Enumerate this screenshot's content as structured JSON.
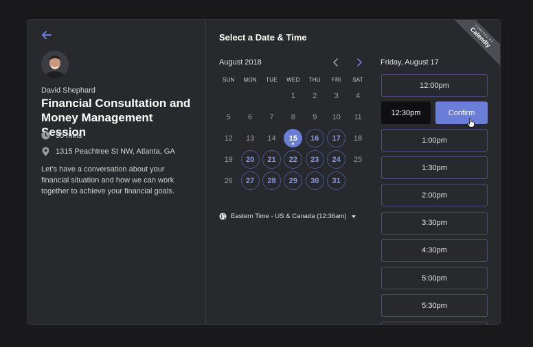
{
  "host": {
    "name": "David Shephard"
  },
  "event": {
    "title": "Financial Consultation and Money Management Session",
    "duration": "30 mins",
    "location": "1315 Peachtree St NW, Atlanta, GA",
    "description": "Let’s have a conversation about your financial situation and how we can work together to achieve your financial goals."
  },
  "scheduler": {
    "title": "Select a Date & Time",
    "month": "August 2018",
    "weekdays": [
      "SUN",
      "MON",
      "TUE",
      "WED",
      "THU",
      "FRI",
      "SAT"
    ],
    "timezone": "Eastern Time - US & Canada (12:36am)"
  },
  "calendar": {
    "leading_blanks": 3,
    "days": [
      {
        "n": "1",
        "available": false
      },
      {
        "n": "2",
        "available": false
      },
      {
        "n": "3",
        "available": false
      },
      {
        "n": "4",
        "available": false
      },
      {
        "n": "5",
        "available": false
      },
      {
        "n": "6",
        "available": false
      },
      {
        "n": "7",
        "available": false
      },
      {
        "n": "8",
        "available": false
      },
      {
        "n": "9",
        "available": false
      },
      {
        "n": "10",
        "available": false
      },
      {
        "n": "11",
        "available": false
      },
      {
        "n": "12",
        "available": false
      },
      {
        "n": "13",
        "available": false
      },
      {
        "n": "14",
        "available": false
      },
      {
        "n": "15",
        "available": true,
        "selected": true
      },
      {
        "n": "16",
        "available": true
      },
      {
        "n": "17",
        "available": true
      },
      {
        "n": "18",
        "available": false
      },
      {
        "n": "19",
        "available": false
      },
      {
        "n": "20",
        "available": true
      },
      {
        "n": "21",
        "available": true
      },
      {
        "n": "22",
        "available": true
      },
      {
        "n": "23",
        "available": true
      },
      {
        "n": "24",
        "available": true
      },
      {
        "n": "25",
        "available": false
      },
      {
        "n": "26",
        "available": false
      },
      {
        "n": "27",
        "available": true
      },
      {
        "n": "28",
        "available": true
      },
      {
        "n": "29",
        "available": true
      },
      {
        "n": "30",
        "available": true
      },
      {
        "n": "31",
        "available": true
      }
    ]
  },
  "times": {
    "date_heading": "Friday, August 17",
    "slots_before": [
      "12:00pm"
    ],
    "selected_time": "12:30pm",
    "confirm_label": "Confirm",
    "slots_after": [
      "1:00pm",
      "1:30pm",
      "2:00pm",
      "3:30pm",
      "4:30pm",
      "5:00pm",
      "5:30pm",
      ""
    ]
  },
  "badge": {
    "powered_by": "POWERED BY",
    "brand": "Calendly"
  },
  "colors": {
    "accent": "#6a7ed8",
    "background": "#19191c",
    "card": "#28292c"
  }
}
